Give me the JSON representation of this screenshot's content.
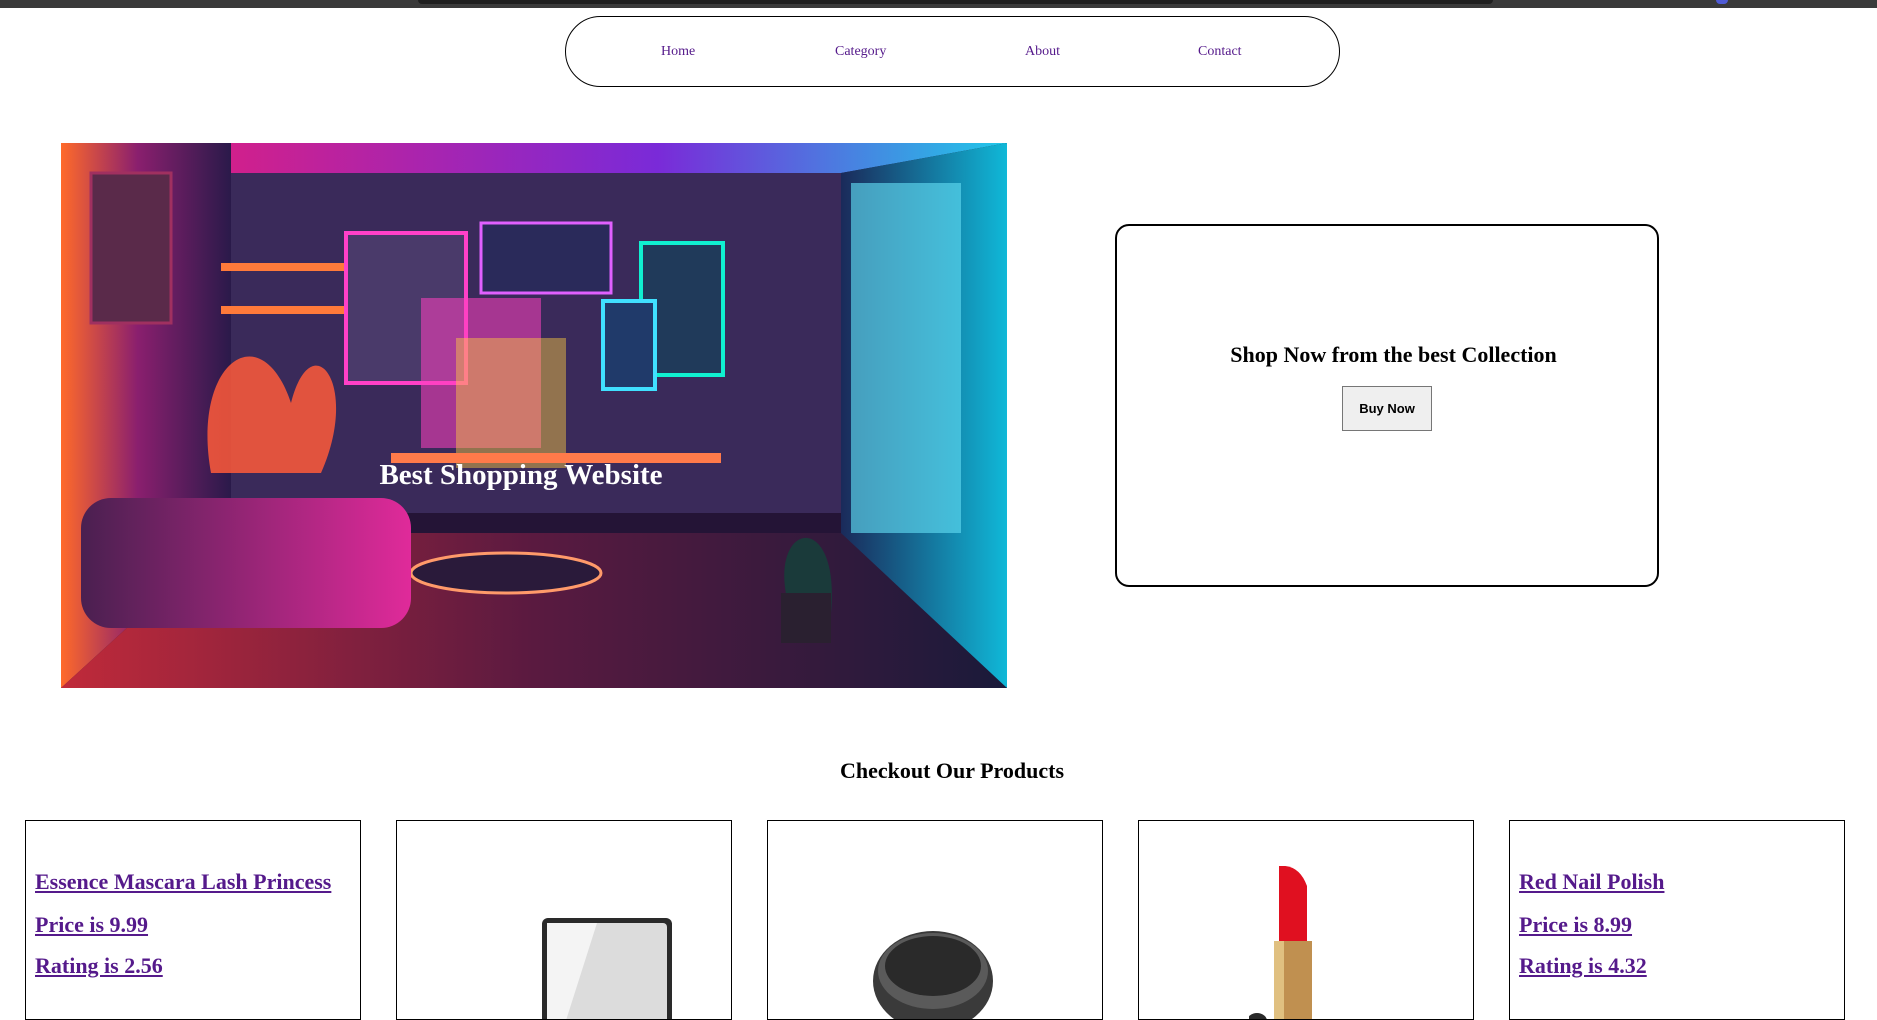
{
  "nav": {
    "links": [
      "Home",
      "Category",
      "About",
      "Contact"
    ]
  },
  "hero": {
    "title": "Best Shopping Website"
  },
  "promo": {
    "text": "Shop Now from the best Collection",
    "button_label": "Buy Now"
  },
  "products_section": {
    "title": "Checkout Our Products"
  },
  "products": [
    {
      "name": "Essence Mascara Lash Princess",
      "price": "Price is 9.99",
      "rating": "Rating is 2.56"
    },
    {
      "image": "mirror"
    },
    {
      "image": "makeup-compact"
    },
    {
      "image": "lipstick"
    },
    {
      "name": "Red Nail Polish",
      "price": "Price is 8.99",
      "rating": "Rating is 4.32"
    }
  ],
  "colors": {
    "link": "#551a8b",
    "border": "#000000"
  }
}
